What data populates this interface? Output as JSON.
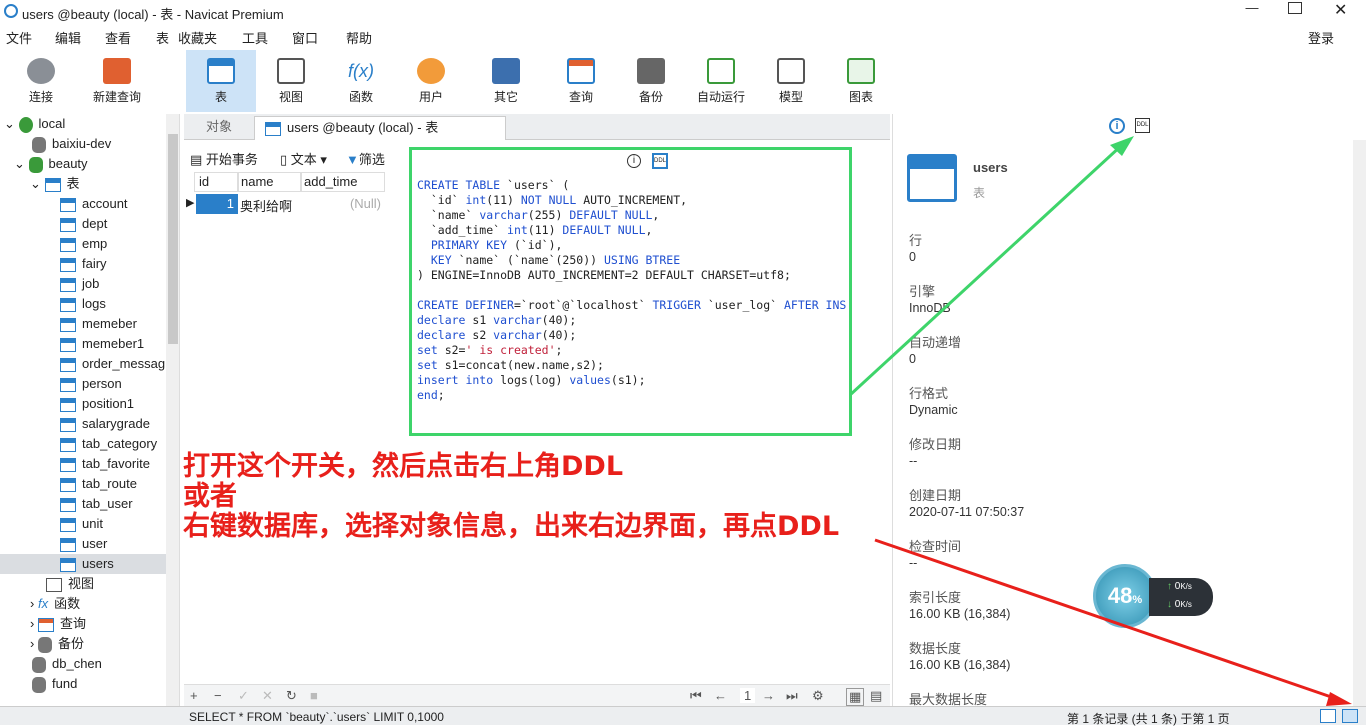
{
  "window": {
    "title": "users @beauty (local) - 表 - Navicat Premium"
  },
  "menu": [
    "文件",
    "编辑",
    "查看",
    "表",
    "收藏夹",
    "工具",
    "窗口",
    "帮助"
  ],
  "login": "登录",
  "toolbar": [
    {
      "label": "连接"
    },
    {
      "label": "新建查询"
    },
    {
      "label": "表"
    },
    {
      "label": "视图"
    },
    {
      "label": "函数"
    },
    {
      "label": "用户"
    },
    {
      "label": "其它"
    },
    {
      "label": "查询"
    },
    {
      "label": "备份"
    },
    {
      "label": "自动运行"
    },
    {
      "label": "模型"
    },
    {
      "label": "图表"
    }
  ],
  "tree": {
    "local": "local",
    "db1": "baixiu-dev",
    "db2": "beauty",
    "tables_group": "表",
    "tables": [
      "account",
      "dept",
      "emp",
      "fairy",
      "job",
      "logs",
      "memeber",
      "memeber1",
      "order_messag",
      "person",
      "position1",
      "salarygrade",
      "tab_category",
      "tab_favorite",
      "tab_route",
      "tab_user",
      "unit",
      "user",
      "users"
    ],
    "views": "视图",
    "functions": "函数",
    "queries": "查询",
    "backup": "备份",
    "db3": "db_chen",
    "db4": "fund"
  },
  "tabs": {
    "objects": "对象",
    "current": "users @beauty (local) - 表"
  },
  "subtoolbar": {
    "begin": "开始事务",
    "text": "文本",
    "filter": "筛选"
  },
  "grid": {
    "columns": [
      "id",
      "name",
      "add_time"
    ],
    "row": {
      "id": "1",
      "name": "奥利给啊",
      "add_time": "(Null)"
    }
  },
  "ddl": {
    "lines": [
      "CREATE TABLE `users` (",
      "  `id` int(11) NOT NULL AUTO_INCREMENT,",
      "  `name` varchar(255) DEFAULT NULL,",
      "  `add_time` int(11) DEFAULT NULL,",
      "  PRIMARY KEY (`id`),",
      "  KEY `name` (`name`(250)) USING BTREE",
      ") ENGINE=InnoDB AUTO_INCREMENT=2 DEFAULT CHARSET=utf8;",
      "",
      "CREATE DEFINER=`root`@`localhost` TRIGGER `user_log` AFTER INS",
      "declare s1 varchar(40);",
      "declare s2 varchar(40);",
      "set s2=' is created';",
      "set s1=concat(new.name,s2);",
      "insert into logs(log) values(s1);",
      "end;"
    ]
  },
  "annotation": [
    "打开这个开关，然后点击右上角DDL",
    "或者",
    "右键数据库，选择对象信息，出来右边界面，再点DDL"
  ],
  "info": {
    "name": "users",
    "type": "表",
    "props": [
      {
        "label": "行",
        "value": "0"
      },
      {
        "label": "引擎",
        "value": "InnoDB"
      },
      {
        "label": "自动递增",
        "value": "0"
      },
      {
        "label": "行格式",
        "value": "Dynamic"
      },
      {
        "label": "修改日期",
        "value": "--"
      },
      {
        "label": "创建日期",
        "value": "2020-07-11 07:50:37"
      },
      {
        "label": "检查时间",
        "value": "--"
      },
      {
        "label": "索引长度",
        "value": "16.00 KB (16,384)"
      },
      {
        "label": "数据长度",
        "value": "16.00 KB (16,384)"
      },
      {
        "label": "最大数据长度",
        "value": ""
      }
    ]
  },
  "widget": {
    "percent": "48",
    "up": "0",
    "down": "0",
    "unit": "K/s"
  },
  "pager": {
    "page": "1"
  },
  "status": {
    "sql": "SELECT * FROM `beauty`.`users` LIMIT 0,1000",
    "records": "第 1 条记录 (共 1 条) 于第 1 页"
  },
  "colors": {
    "accent": "#2a7fc9",
    "annotation": "#e8201b",
    "highlight_box": "#3ed46a"
  }
}
